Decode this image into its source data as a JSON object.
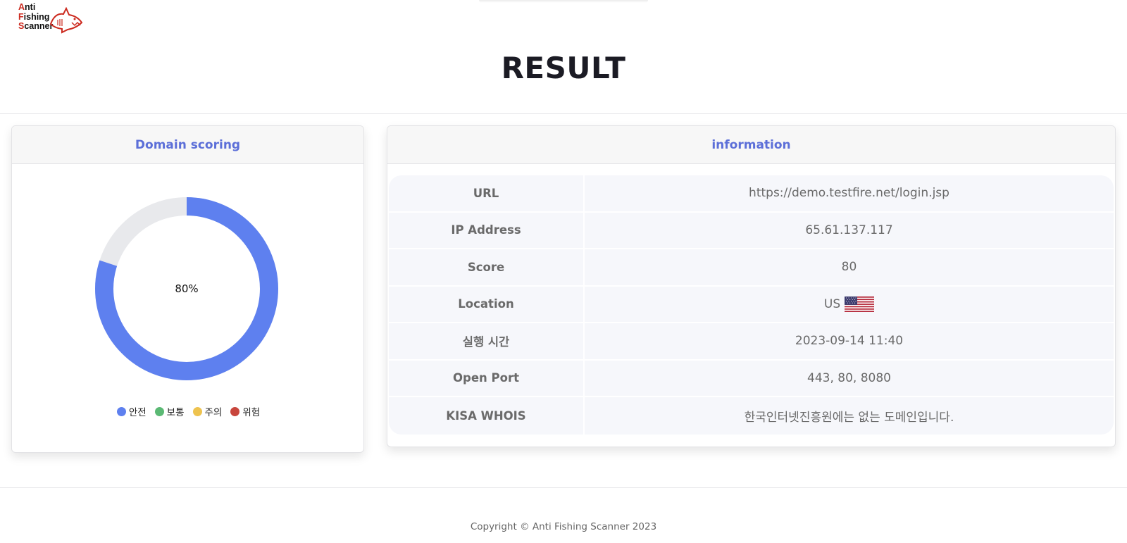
{
  "logo": {
    "line1_cap": "A",
    "line1_rest": "nti",
    "line2_cap": "F",
    "line2_rest": "ishing",
    "line3_cap": "S",
    "line3_rest": "canner"
  },
  "page_title": "RESULT",
  "scoring_card": {
    "title": "Domain scoring",
    "score_label": "80%",
    "score_value": 80,
    "colors": {
      "filled": "#5e80ef",
      "empty": "#e8e9ec"
    },
    "legend": [
      {
        "label": "안전",
        "color": "#5e80ef"
      },
      {
        "label": "보통",
        "color": "#5bb974"
      },
      {
        "label": "주의",
        "color": "#eec34f"
      },
      {
        "label": "위험",
        "color": "#c8463d"
      }
    ]
  },
  "info_card": {
    "title": "information",
    "rows": [
      {
        "key": "URL",
        "value": "https://demo.testfire.net/login.jsp"
      },
      {
        "key": "IP Address",
        "value": "65.61.137.117"
      },
      {
        "key": "Score",
        "value": "80"
      },
      {
        "key": "Location",
        "value": "US",
        "icon": "us-flag-icon"
      },
      {
        "key": "실행 시간",
        "value": "2023-09-14 11:40"
      },
      {
        "key": "Open Port",
        "value": "443, 80, 8080"
      },
      {
        "key": "KISA WHOIS",
        "value": "한국인터넷진흥원에는 없는 도메인입니다."
      }
    ]
  },
  "footer": {
    "copyright": "Copyright © Anti Fishing Scanner 2023"
  }
}
